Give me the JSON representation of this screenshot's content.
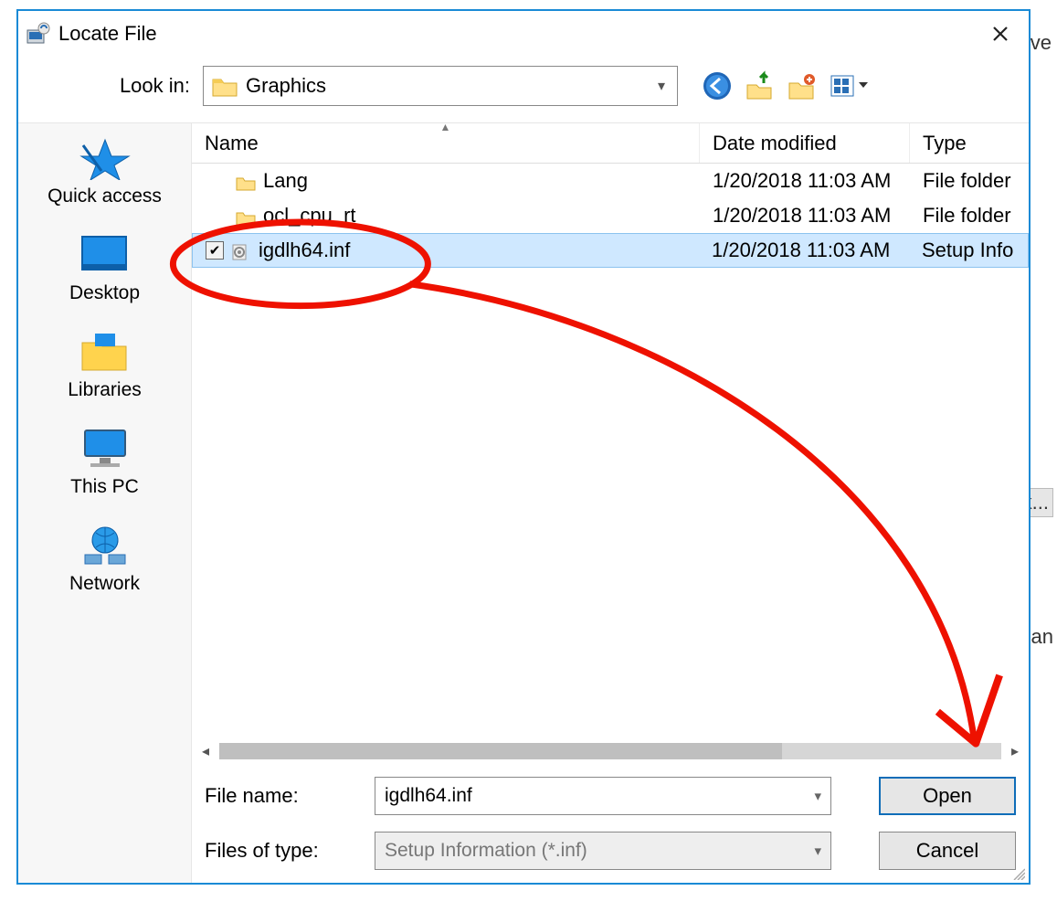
{
  "background_fragments": {
    "ave": "ave",
    "k": "k...",
    "can": "Can"
  },
  "dialog": {
    "title": "Locate File",
    "lookin_label": "Look in:",
    "lookin_value": "Graphics",
    "columns": {
      "name": "Name",
      "date": "Date modified",
      "type": "Type"
    },
    "rows": [
      {
        "icon": "folder",
        "checkbox": false,
        "name": "Lang",
        "date": "1/20/2018 11:03 AM",
        "type": "File folder",
        "selected": false
      },
      {
        "icon": "folder",
        "checkbox": false,
        "name": "ocl_cpu_rt",
        "date": "1/20/2018 11:03 AM",
        "type": "File folder",
        "selected": false
      },
      {
        "icon": "inf",
        "checkbox": true,
        "name": "igdlh64.inf",
        "date": "1/20/2018 11:03 AM",
        "type": "Setup Info",
        "selected": true
      }
    ],
    "places": [
      {
        "id": "quick-access",
        "label": "Quick access"
      },
      {
        "id": "desktop",
        "label": "Desktop"
      },
      {
        "id": "libraries",
        "label": "Libraries"
      },
      {
        "id": "this-pc",
        "label": "This PC"
      },
      {
        "id": "network",
        "label": "Network"
      }
    ],
    "file_name_label": "File name:",
    "file_name_value": "igdlh64.inf",
    "file_type_label": "Files of type:",
    "file_type_value": "Setup Information (*.inf)",
    "open_label": "Open",
    "cancel_label": "Cancel"
  }
}
